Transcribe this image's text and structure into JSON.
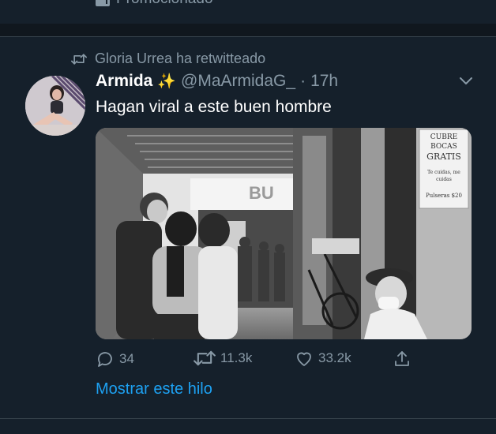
{
  "promo": {
    "label": "Promocionado"
  },
  "retweet": {
    "text": "Gloria Urrea ha retwitteado"
  },
  "tweet": {
    "name": "Armida",
    "name_emoji": "✨",
    "handle": "@MaArmidaG_",
    "dot": "·",
    "time": "17h",
    "text": "Hagan viral a este buen hombre",
    "media": {
      "store_sign": "BU",
      "sign_line1": "CUBRE",
      "sign_line2": "BOCAS",
      "sign_line3": "GRATIS",
      "sign_line4": "Te cuidas, me",
      "sign_line5": "cuidas",
      "sign_line6": "Pulseras $20"
    },
    "actions": {
      "replies": "34",
      "retweets": "11.3k",
      "likes": "33.2k"
    },
    "show_thread": "Mostrar este hilo"
  },
  "colors": {
    "background": "#15202b",
    "secondary_text": "#8899a6",
    "link": "#1da1f2",
    "separator": "#38444d"
  }
}
